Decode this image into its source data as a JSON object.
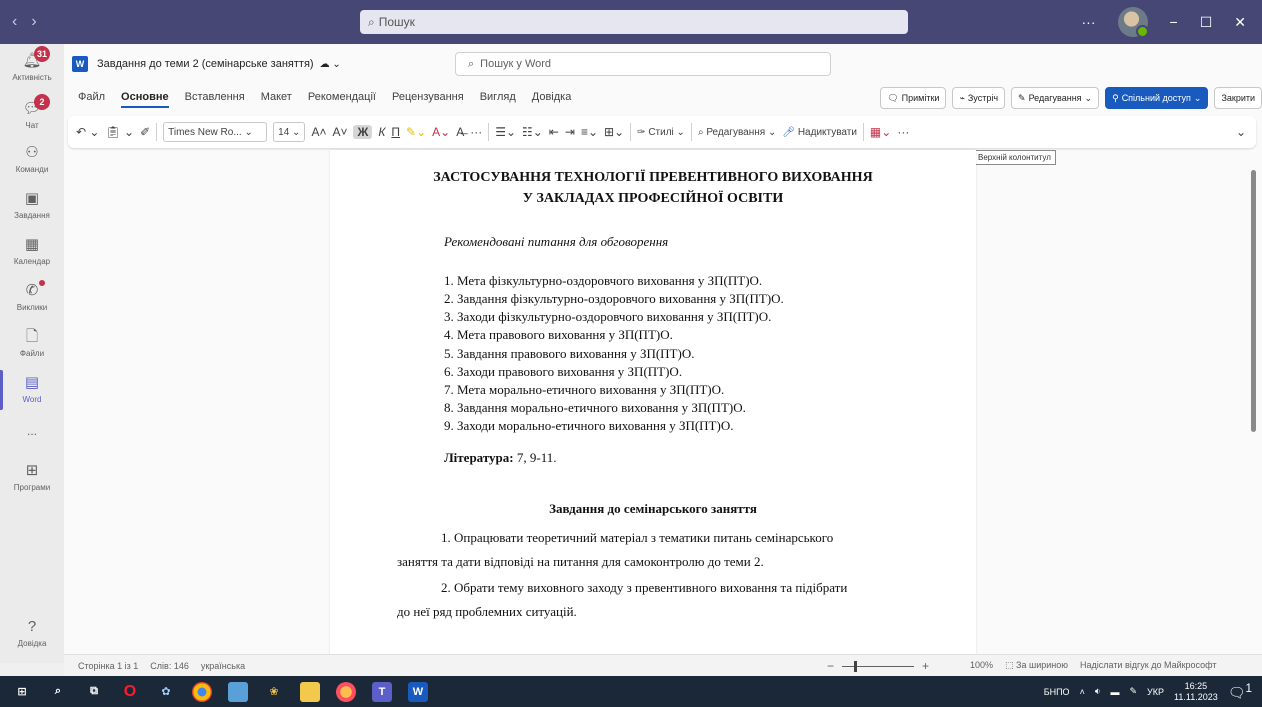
{
  "teams": {
    "search_placeholder": "Пошук",
    "more": "···",
    "minimize": "−",
    "maximize": "☐",
    "close": "✕"
  },
  "rail": [
    {
      "label": "Активність",
      "badge": "31",
      "icon": "bell-icon"
    },
    {
      "label": "Чат",
      "badge": "2",
      "icon": "chat-icon"
    },
    {
      "label": "Команди",
      "icon": "teams-icon"
    },
    {
      "label": "Завдання",
      "icon": "assignments-icon"
    },
    {
      "label": "Календар",
      "icon": "calendar-icon"
    },
    {
      "label": "Виклики",
      "icon": "phone-icon"
    },
    {
      "label": "Файли",
      "icon": "file-icon"
    },
    {
      "label": "Word",
      "icon": "word-icon",
      "active": true
    },
    {
      "label": "...",
      "icon": "more-icon"
    },
    {
      "label": "Програми",
      "icon": "apps-icon"
    },
    {
      "label": "Довідка",
      "icon": "help-icon"
    }
  ],
  "doc": {
    "title": "Завдання до теми 2 (семінарське заняття)",
    "search_placeholder": "Пошук у Word"
  },
  "menu": {
    "tabs": [
      "Файл",
      "Основне",
      "Вставлення",
      "Макет",
      "Рекомендації",
      "Рецензування",
      "Вигляд",
      "Довідка"
    ],
    "active": "Основне",
    "comments": "Примітки",
    "meetings": "Зустріч",
    "editing": "Редагування",
    "share": "Спільний доступ",
    "close": "Закрити"
  },
  "ribbon": {
    "font": "Times New Ro...",
    "size": "14",
    "bold": "Ж",
    "italic": "К",
    "underline": "П",
    "styles": "Стилі",
    "editing": "Редагування",
    "dictate": "Надиктувати",
    "more": "···"
  },
  "tooltip": "Верхній колонтитул",
  "page": {
    "title1": "ЗАСТОСУВАННЯ ТЕХНОЛОГІЇ ПРЕВЕНТИВНОГО ВИХОВАННЯ",
    "title2": "У ЗАКЛАДАХ ПРОФЕСІЙНОЇ ОСВІТИ",
    "subtitle": "Рекомендовані питання для обговорення",
    "questions": [
      "1. Мета фізкультурно-оздоровчого виховання у ЗП(ПТ)О.",
      "2. Завдання фізкультурно-оздоровчого виховання у ЗП(ПТ)О.",
      "3. Заходи фізкультурно-оздоровчого виховання у ЗП(ПТ)О.",
      "4. Мета правового виховання у ЗП(ПТ)О.",
      "5. Завдання правового виховання у ЗП(ПТ)О.",
      "6. Заходи правового виховання у ЗП(ПТ)О.",
      "7. Мета морально-етичного виховання у ЗП(ПТ)О.",
      "8. Завдання морально-етичного виховання у ЗП(ПТ)О.",
      "9. Заходи морально-етичного виховання у ЗП(ПТ)О."
    ],
    "lit_label": "Література:",
    "lit_value": " 7, 9-11.",
    "tasks_title": "Завдання до семінарського заняття",
    "task1_a": "1. Опрацювати теоретичний матеріал з тематики питань семінарського",
    "task1_b": "заняття та дати відповіді на питання для самоконтролю до теми 2.",
    "task2_a": "2. Обрати тему виховного заходу з превентивного виховання та підібрати",
    "task2_b": "до неї ряд проблемних ситуацій."
  },
  "status": {
    "page": "Сторінка 1 із 1",
    "words": "Слів: 146",
    "lang": "українська",
    "zoom_minus": "−",
    "zoom_plus": "+",
    "zoom": "100%",
    "fit": "За шириною",
    "feedback": "Надіслати відгук до Майкрософт"
  },
  "taskbar": {
    "lang1": "БНПО",
    "lang2": "УКР",
    "time": "16:25",
    "date": "11.11.2023",
    "notif": "1"
  }
}
